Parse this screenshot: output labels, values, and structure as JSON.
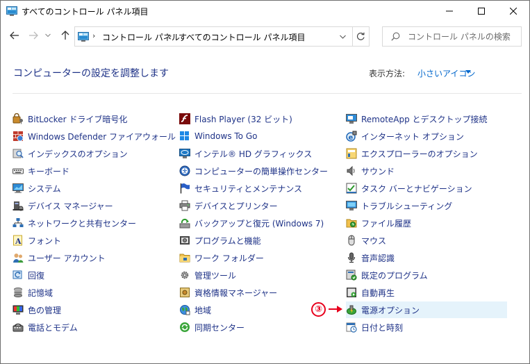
{
  "window": {
    "title": "すべてのコントロール パネル項目"
  },
  "navigation": {
    "breadcrumbs": [
      "コントロール パネル",
      "すべてのコントロール パネル項目"
    ],
    "search_placeholder": "コントロール パネルの検索"
  },
  "header": {
    "title": "コンピューターの設定を調整します",
    "view_label": "表示方法:",
    "view_value": "小さいアイコン"
  },
  "items": {
    "col1": [
      {
        "label": "BitLocker ドライブ暗号化",
        "icon": "bitlocker-icon"
      },
      {
        "label": "Windows Defender ファイアウォール",
        "icon": "firewall-icon"
      },
      {
        "label": "インデックスのオプション",
        "icon": "indexing-icon"
      },
      {
        "label": "キーボード",
        "icon": "keyboard-icon"
      },
      {
        "label": "システム",
        "icon": "system-icon"
      },
      {
        "label": "デバイス マネージャー",
        "icon": "device-manager-icon"
      },
      {
        "label": "ネットワークと共有センター",
        "icon": "network-icon"
      },
      {
        "label": "フォント",
        "icon": "fonts-icon"
      },
      {
        "label": "ユーザー アカウント",
        "icon": "user-accounts-icon"
      },
      {
        "label": "回復",
        "icon": "recovery-icon"
      },
      {
        "label": "記憶域",
        "icon": "storage-icon"
      },
      {
        "label": "色の管理",
        "icon": "color-management-icon"
      },
      {
        "label": "電話とモデム",
        "icon": "phone-modem-icon"
      }
    ],
    "col2": [
      {
        "label": "Flash Player (32 ビット)",
        "icon": "flash-icon"
      },
      {
        "label": "Windows To Go",
        "icon": "windows-to-go-icon"
      },
      {
        "label": "インテル® HD グラフィックス",
        "icon": "intel-graphics-icon"
      },
      {
        "label": "コンピューターの簡単操作センター",
        "icon": "ease-of-access-icon"
      },
      {
        "label": "セキュリティとメンテナンス",
        "icon": "security-flag-icon"
      },
      {
        "label": "デバイスとプリンター",
        "icon": "printer-icon"
      },
      {
        "label": "バックアップと復元 (Windows 7)",
        "icon": "backup-icon"
      },
      {
        "label": "プログラムと機能",
        "icon": "programs-icon"
      },
      {
        "label": "ワーク フォルダー",
        "icon": "work-folders-icon"
      },
      {
        "label": "管理ツール",
        "icon": "admin-tools-icon"
      },
      {
        "label": "資格情報マネージャー",
        "icon": "credential-icon"
      },
      {
        "label": "地域",
        "icon": "region-icon"
      },
      {
        "label": "同期センター",
        "icon": "sync-icon"
      }
    ],
    "col3": [
      {
        "label": "RemoteApp とデスクトップ接続",
        "icon": "remoteapp-icon"
      },
      {
        "label": "インターネット オプション",
        "icon": "internet-options-icon"
      },
      {
        "label": "エクスプローラーのオプション",
        "icon": "explorer-options-icon"
      },
      {
        "label": "サウンド",
        "icon": "sound-icon"
      },
      {
        "label": "タスク バーとナビゲーション",
        "icon": "taskbar-icon"
      },
      {
        "label": "トラブルシューティング",
        "icon": "troubleshooting-icon"
      },
      {
        "label": "ファイル履歴",
        "icon": "file-history-icon"
      },
      {
        "label": "マウス",
        "icon": "mouse-icon"
      },
      {
        "label": "音声認識",
        "icon": "microphone-icon"
      },
      {
        "label": "既定のプログラム",
        "icon": "default-programs-icon"
      },
      {
        "label": "自動再生",
        "icon": "autoplay-icon"
      },
      {
        "label": "電源オプション",
        "icon": "power-options-icon"
      },
      {
        "label": "日付と時刻",
        "icon": "clock-icon"
      }
    ]
  },
  "annotation": {
    "marker": "③",
    "color": "#e8001c"
  },
  "colors": {
    "link": "#1e3287",
    "accent": "#0066cc",
    "highlight": "#e5f3fb"
  }
}
